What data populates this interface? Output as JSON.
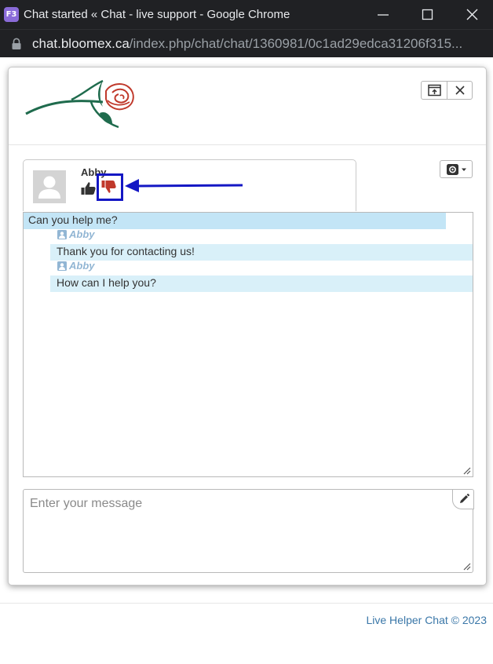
{
  "window": {
    "app_icon_text": "F3",
    "title": "Chat started « Chat - live support - Google Chrome"
  },
  "address_bar": {
    "host": "chat.bloomex.ca",
    "path": "/index.php/chat/chat/1360981/0c1ad29edca31206f315..."
  },
  "header": {
    "logo": "rose-logo-icon",
    "popup_icon": "popup-window-icon",
    "close_icon": "close-icon"
  },
  "operator": {
    "name": "Abby",
    "thumbs_up_icon": "thumbs-up-icon",
    "thumbs_down_icon": "thumbs-down-icon",
    "thumbs_down_color": "#c0392b",
    "annotation_color": "#1417c4"
  },
  "messages": [
    {
      "from": "visitor",
      "text": "Can you help me?"
    },
    {
      "from": "operator",
      "author": "Abby",
      "text": "Thank you for contacting us!"
    },
    {
      "from": "operator",
      "author": "Abby",
      "text": "How can I help you?"
    }
  ],
  "input": {
    "placeholder": "Enter your message",
    "value": ""
  },
  "footer": {
    "text": "Live Helper Chat © 2023",
    "link_color": "#3a77a8"
  },
  "colors": {
    "visitor_bubble": "#c3e5f6",
    "operator_bubble": "#d9f0f9",
    "author_name": "#92b6d4"
  }
}
